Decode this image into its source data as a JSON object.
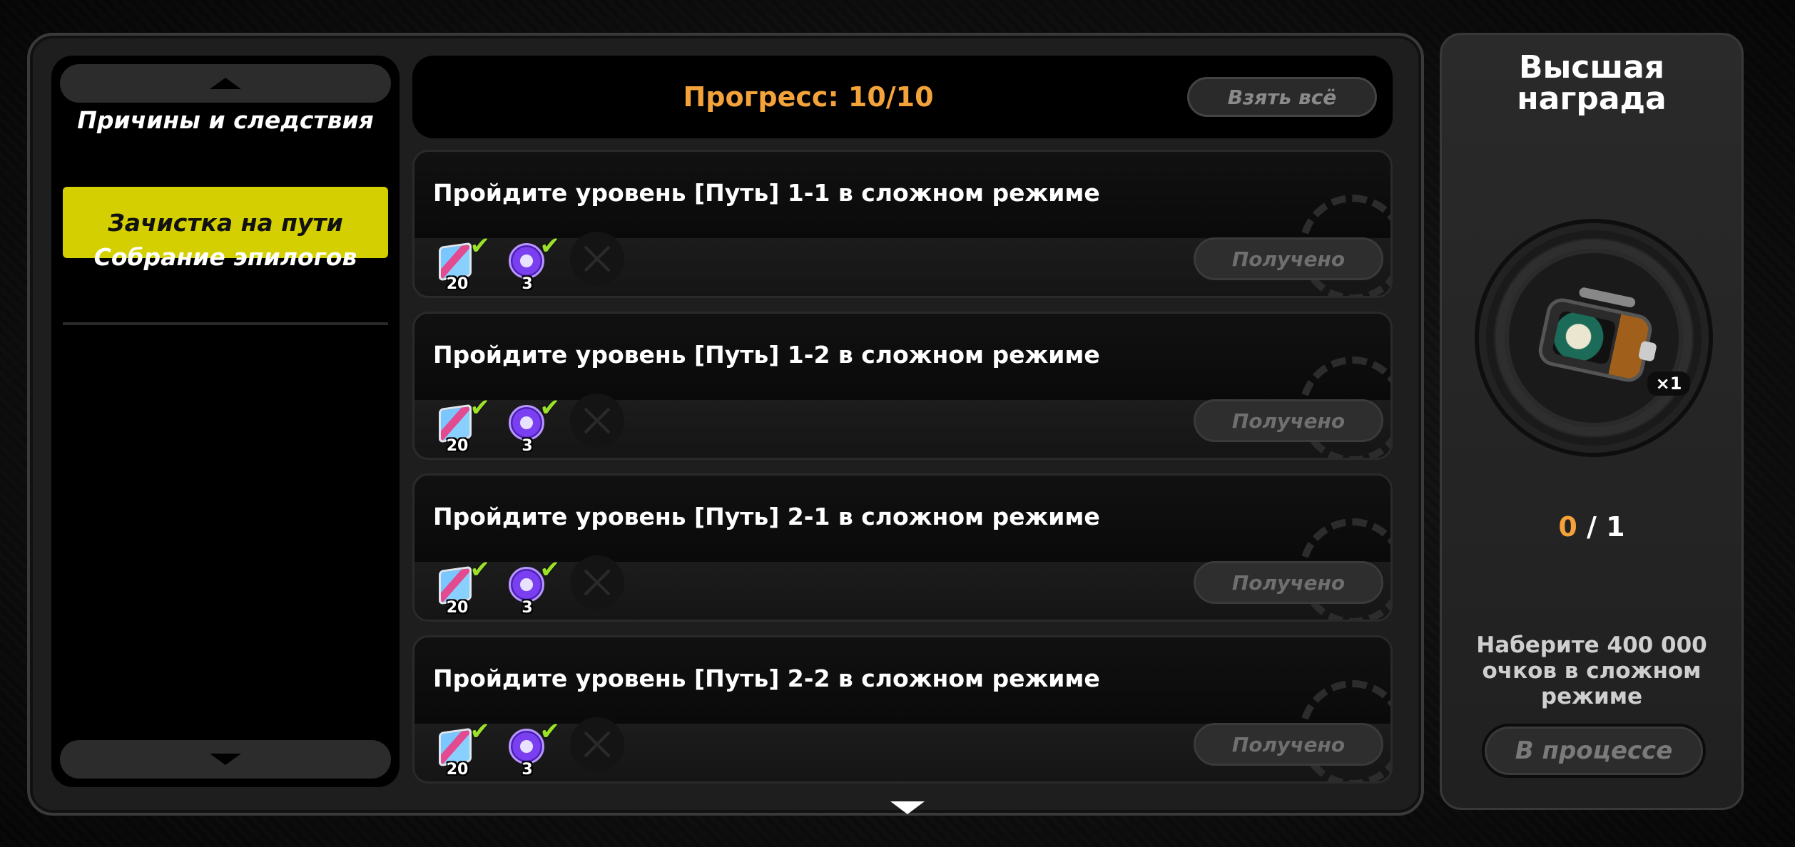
{
  "sidebar": {
    "items": [
      {
        "label": "Причины и следствия",
        "active": false
      },
      {
        "label": "Зачистка на пути",
        "active": true
      },
      {
        "label": "Собрание эпилогов",
        "active": false
      }
    ]
  },
  "header": {
    "progress_label": "Прогресс: 10/10",
    "take_all_label": "Взять всё"
  },
  "tasks": [
    {
      "title": "Пройдите уровень [Путь] 1-1 в сложном режиме",
      "reward1_count": "20",
      "reward2_count": "3",
      "status": "Получено"
    },
    {
      "title": "Пройдите уровень [Путь] 1-2 в сложном режиме",
      "reward1_count": "20",
      "reward2_count": "3",
      "status": "Получено"
    },
    {
      "title": "Пройдите уровень [Путь] 2-1 в сложном режиме",
      "reward1_count": "20",
      "reward2_count": "3",
      "status": "Получено"
    },
    {
      "title": "Пройдите уровень [Путь] 2-2 в сложном режиме",
      "reward1_count": "20",
      "reward2_count": "3",
      "status": "Получено"
    }
  ],
  "top_reward": {
    "title_line1": "Высшая",
    "title_line2": "награда",
    "item_quantity": "×1",
    "current": "0",
    "separator": " / ",
    "total": "1",
    "description": "Наберите 400 000 очков в сложном режиме",
    "status_label": "В процессе"
  },
  "colors": {
    "accent_orange": "#f4a23a",
    "active_tab_yellow": "#d4cf00",
    "check_green": "#9be12a"
  }
}
